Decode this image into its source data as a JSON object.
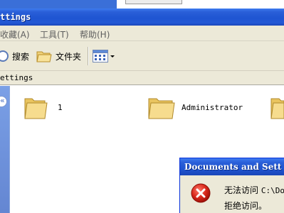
{
  "window": {
    "title": "ttings"
  },
  "menu": {
    "items": [
      "收藏(A)",
      "工具(T)",
      "帮助(H)"
    ]
  },
  "toolbar": {
    "search_label": "搜索",
    "folders_label": "文件夹"
  },
  "address": {
    "value": "ettings"
  },
  "folders": [
    {
      "name": "1"
    },
    {
      "name": "Administrator"
    },
    {
      "name": ""
    }
  ],
  "dialog": {
    "title": "Documents and Sett",
    "message_prefix": "无法访问 ",
    "message_path": "C:\\Doc",
    "message_line2": "拒绝访问。"
  },
  "colors": {
    "titlebar": "#1f55d2",
    "chrome": "#ece9d8",
    "folder": "#f3d97b",
    "error": "#d8281b"
  }
}
